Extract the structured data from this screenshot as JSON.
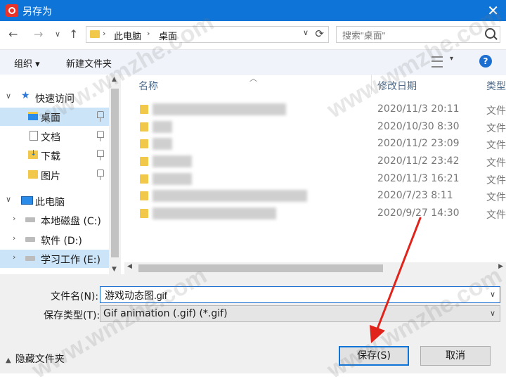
{
  "window": {
    "title": "另存为",
    "close_label": "✕"
  },
  "toolbar": {
    "back_label": "←",
    "forward_label": "→",
    "recent_label": "∨",
    "up_label": "↑",
    "breadcrumb": [
      "此电脑",
      "桌面"
    ],
    "search_placeholder": "搜索\"桌面\""
  },
  "commands": {
    "organize": "组织 ▾",
    "new_folder": "新建文件夹",
    "help": "?"
  },
  "nav": {
    "quick_access": "快速访问",
    "desktop": "桌面",
    "documents": "文档",
    "downloads": "下载",
    "pictures": "图片",
    "this_pc": "此电脑",
    "drive_c": "本地磁盘 (C:)",
    "drive_d": "软件 (D:)",
    "drive_e": "学习工作 (E:)"
  },
  "columns": {
    "name": "名称",
    "date": "修改日期",
    "type": "类型"
  },
  "files": [
    {
      "date": "2020/11/3 20:11",
      "type": "文件"
    },
    {
      "date": "2020/10/30 8:30",
      "type": "文件"
    },
    {
      "date": "2020/11/2 23:09",
      "type": "文件"
    },
    {
      "date": "2020/11/2 23:42",
      "type": "文件"
    },
    {
      "date": "2020/11/3 16:21",
      "type": "文件"
    },
    {
      "date": "2020/7/23 8:11",
      "type": "文件"
    },
    {
      "date": "2020/9/27 14:30",
      "type": "文件"
    }
  ],
  "form": {
    "filename_label": "文件名(N):",
    "filename_value": "游戏动态图.gif",
    "filetype_label": "保存类型(T):",
    "filetype_value": "Gif animation (.gif) (*.gif)"
  },
  "footer": {
    "hide_folders": "隐藏文件夹",
    "save": "保存(S)",
    "cancel": "取消"
  },
  "watermark": "www.wmzhe.com",
  "colors": {
    "titlebar": "#0f74d7",
    "selection": "#cce4f7",
    "annotation_arrow": "#e0231b"
  }
}
